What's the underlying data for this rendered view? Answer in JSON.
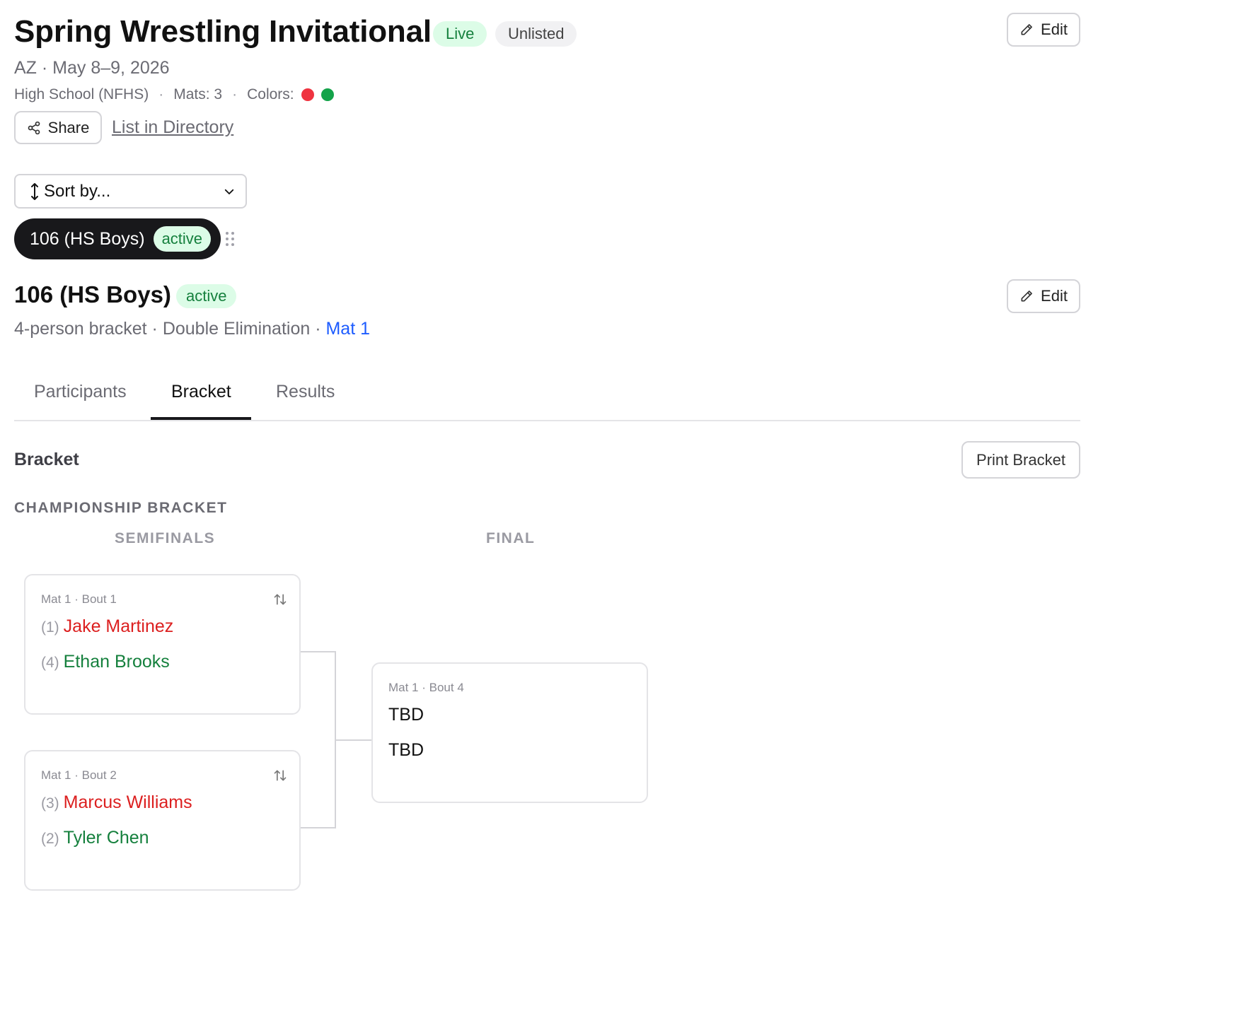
{
  "tournament": {
    "title": "Spring Wrestling Invitational",
    "status_live": "Live",
    "status_listing": "Unlisted",
    "edit_label": "Edit",
    "location_date": "AZ · May 8–9, 2026",
    "level": "High School (NFHS)",
    "mats": "Mats: 3",
    "colors_label": "Colors:",
    "colors": [
      "#ef3340",
      "#14a34a"
    ],
    "share_label": "Share",
    "directory_link": "List in Directory"
  },
  "sort": {
    "label": "Sort by..."
  },
  "weight_chip": {
    "label": "106 (HS Boys)",
    "status": "active"
  },
  "division": {
    "title": "106 (HS Boys)",
    "status": "active",
    "edit_label": "Edit",
    "summary": "4-person bracket · Double Elimination · ",
    "mat": "Mat 1"
  },
  "tabs": [
    {
      "label": "Participants",
      "active": false
    },
    {
      "label": "Bracket",
      "active": true
    },
    {
      "label": "Results",
      "active": false
    }
  ],
  "bracket": {
    "section_title": "Bracket",
    "print_label": "Print Bracket",
    "group_title": "CHAMPIONSHIP BRACKET",
    "rounds": [
      "SEMIFINALS",
      "FINAL"
    ],
    "matches": [
      {
        "header": "Mat 1 · Bout 1",
        "top": {
          "seed": "(1)",
          "name": "Jake Martinez"
        },
        "bottom": {
          "seed": "(4)",
          "name": "Ethan Brooks"
        }
      },
      {
        "header": "Mat 1 · Bout 2",
        "top": {
          "seed": "(3)",
          "name": "Marcus Williams"
        },
        "bottom": {
          "seed": "(2)",
          "name": "Tyler Chen"
        }
      },
      {
        "header": "Mat 1 · Bout 4",
        "top": {
          "name": "TBD"
        },
        "bottom": {
          "name": "TBD"
        }
      }
    ]
  }
}
